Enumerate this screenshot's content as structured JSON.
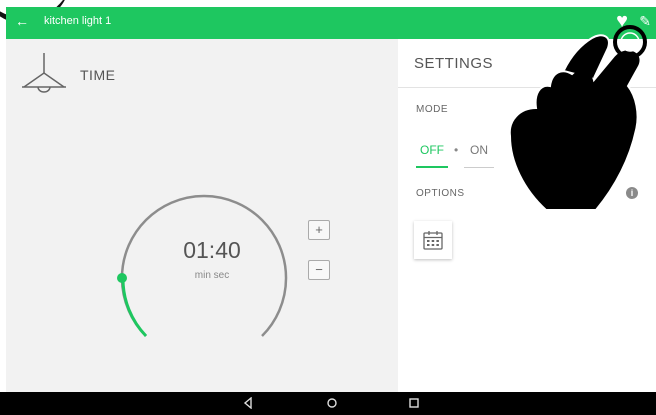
{
  "appbar": {
    "title": "kitchen light 1",
    "back_icon": "arrow-back-icon",
    "favorite_icon": "heart-icon",
    "edit_icon": "pencil-icon"
  },
  "timer": {
    "label": "TIME",
    "value": "01:40",
    "unit": "min  sec",
    "plus": "+",
    "minus": "−"
  },
  "settings": {
    "title": "SETTINGS",
    "mode_label": "MODE",
    "mode_off": "OFF",
    "mode_separator": "•",
    "mode_on": "ON",
    "options_label": "OPTIONS",
    "info": "i"
  },
  "colors": {
    "accent": "#1ec760",
    "navbar": "#000000"
  }
}
